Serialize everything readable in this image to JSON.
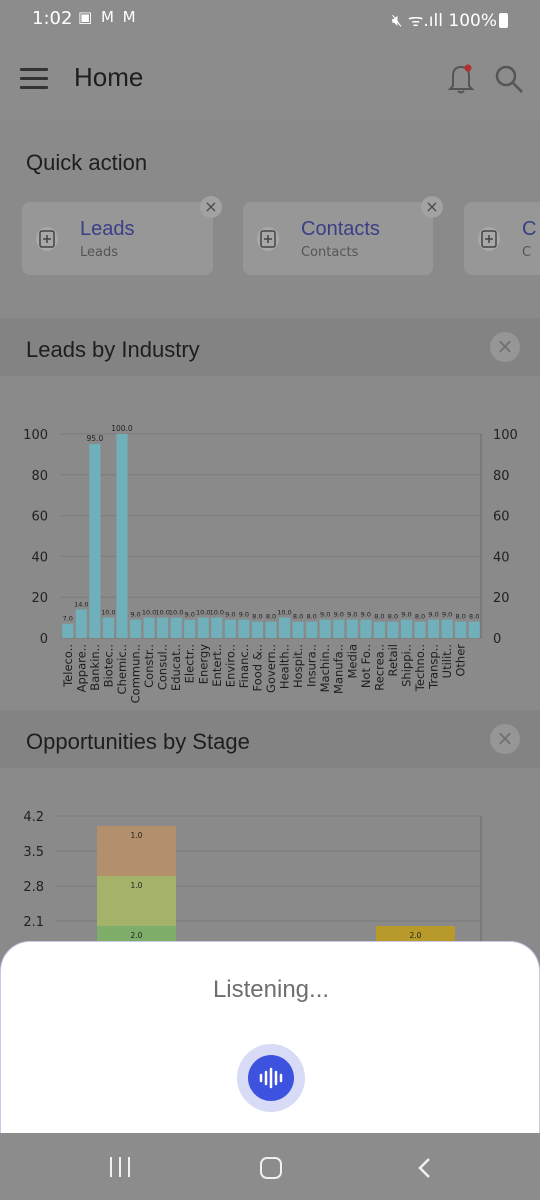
{
  "status_bar": {
    "time": "1:02",
    "left_icons": "▣ M M",
    "wifi_signal": "ᯤ.ıll",
    "battery": "100%"
  },
  "app_bar": {
    "title": "Home"
  },
  "quick_action": {
    "title": "Quick action",
    "cards": [
      {
        "title": "Leads",
        "subtitle": "Leads"
      },
      {
        "title": "Contacts",
        "subtitle": "Contacts"
      },
      {
        "title": "C",
        "subtitle": "C"
      }
    ]
  },
  "leads_by_industry": {
    "title": "Leads by Industry",
    "close": "×"
  },
  "opportunities_by_stage": {
    "title": "Opportunities by Stage",
    "close": "×"
  },
  "voice_sheet": {
    "status": "Listening..."
  },
  "colors": {
    "bar": "#6fb0bb",
    "accent": "#3d53e0",
    "link": "#3a3f86"
  },
  "icons": {
    "menu": "hamburger-icon",
    "notifications": "bell-icon",
    "search": "search-icon",
    "mic": "voice-wave-icon",
    "recent": "recent-apps-icon",
    "home": "home-icon",
    "back": "back-icon"
  },
  "chart_data": [
    {
      "type": "bar",
      "title": "Leads by Industry",
      "categories": [
        "Teleco..",
        "Appare..",
        "Bankin..",
        "Biotec..",
        "Chemic..",
        "Commun..",
        "Constr..",
        "Consul..",
        "Educat..",
        "Electr..",
        "Energy",
        "Entert..",
        "Enviro..",
        "Financ..",
        "Food &..",
        "Govern..",
        "Health..",
        "Hospit..",
        "Insura..",
        "Machin..",
        "Manufa..",
        "Media",
        "Not Fo..",
        "Recrea..",
        "Retail",
        "Shippi..",
        "Techno..",
        "Transp..",
        "Utilit..",
        "Other"
      ],
      "values": [
        7,
        14,
        95,
        10,
        100,
        9,
        10,
        10,
        10,
        9,
        10,
        10,
        9,
        9,
        8,
        8,
        10,
        8,
        8,
        9,
        9,
        9,
        9,
        8,
        8,
        9,
        8,
        9,
        9,
        8,
        8
      ],
      "data_labels": [
        "7.0",
        "14.0",
        "95.0",
        "10.0",
        "100.0",
        "9.0",
        "10.0",
        "10.0",
        "10.0",
        "9.0",
        "10.0",
        "10.0",
        "9.0",
        "9.0",
        "8.0",
        "8.0",
        "10.0",
        "8.0",
        "8.0",
        "9.0",
        "9.0",
        "9.0",
        "9.0",
        "8.0",
        "8.0",
        "9.0",
        "8.0",
        "9.0",
        "9.0",
        "8.0",
        "8.0"
      ],
      "y_ticks": [
        "0",
        "20",
        "40",
        "60",
        "80",
        "100"
      ],
      "ylim": [
        0,
        100
      ],
      "grid": true
    },
    {
      "type": "bar",
      "title": "Opportunities by Stage",
      "stacked": true,
      "y_ticks": [
        "2.1",
        "2.8",
        "3.5",
        "4.2"
      ],
      "segments": [
        {
          "category": 0,
          "value": 2.0,
          "label": "2.0",
          "color": "#7fae6b"
        },
        {
          "category": 0,
          "value": 1.0,
          "label": "1.0",
          "color": "#a5b26a"
        },
        {
          "category": 0,
          "value": 1.0,
          "label": "1.0",
          "color": "#b48f6c"
        },
        {
          "category": 2,
          "value": 2.0,
          "label": "2.0",
          "color": "#b89a2b"
        }
      ],
      "ylim": [
        0,
        4.2
      ],
      "grid": true
    }
  ]
}
